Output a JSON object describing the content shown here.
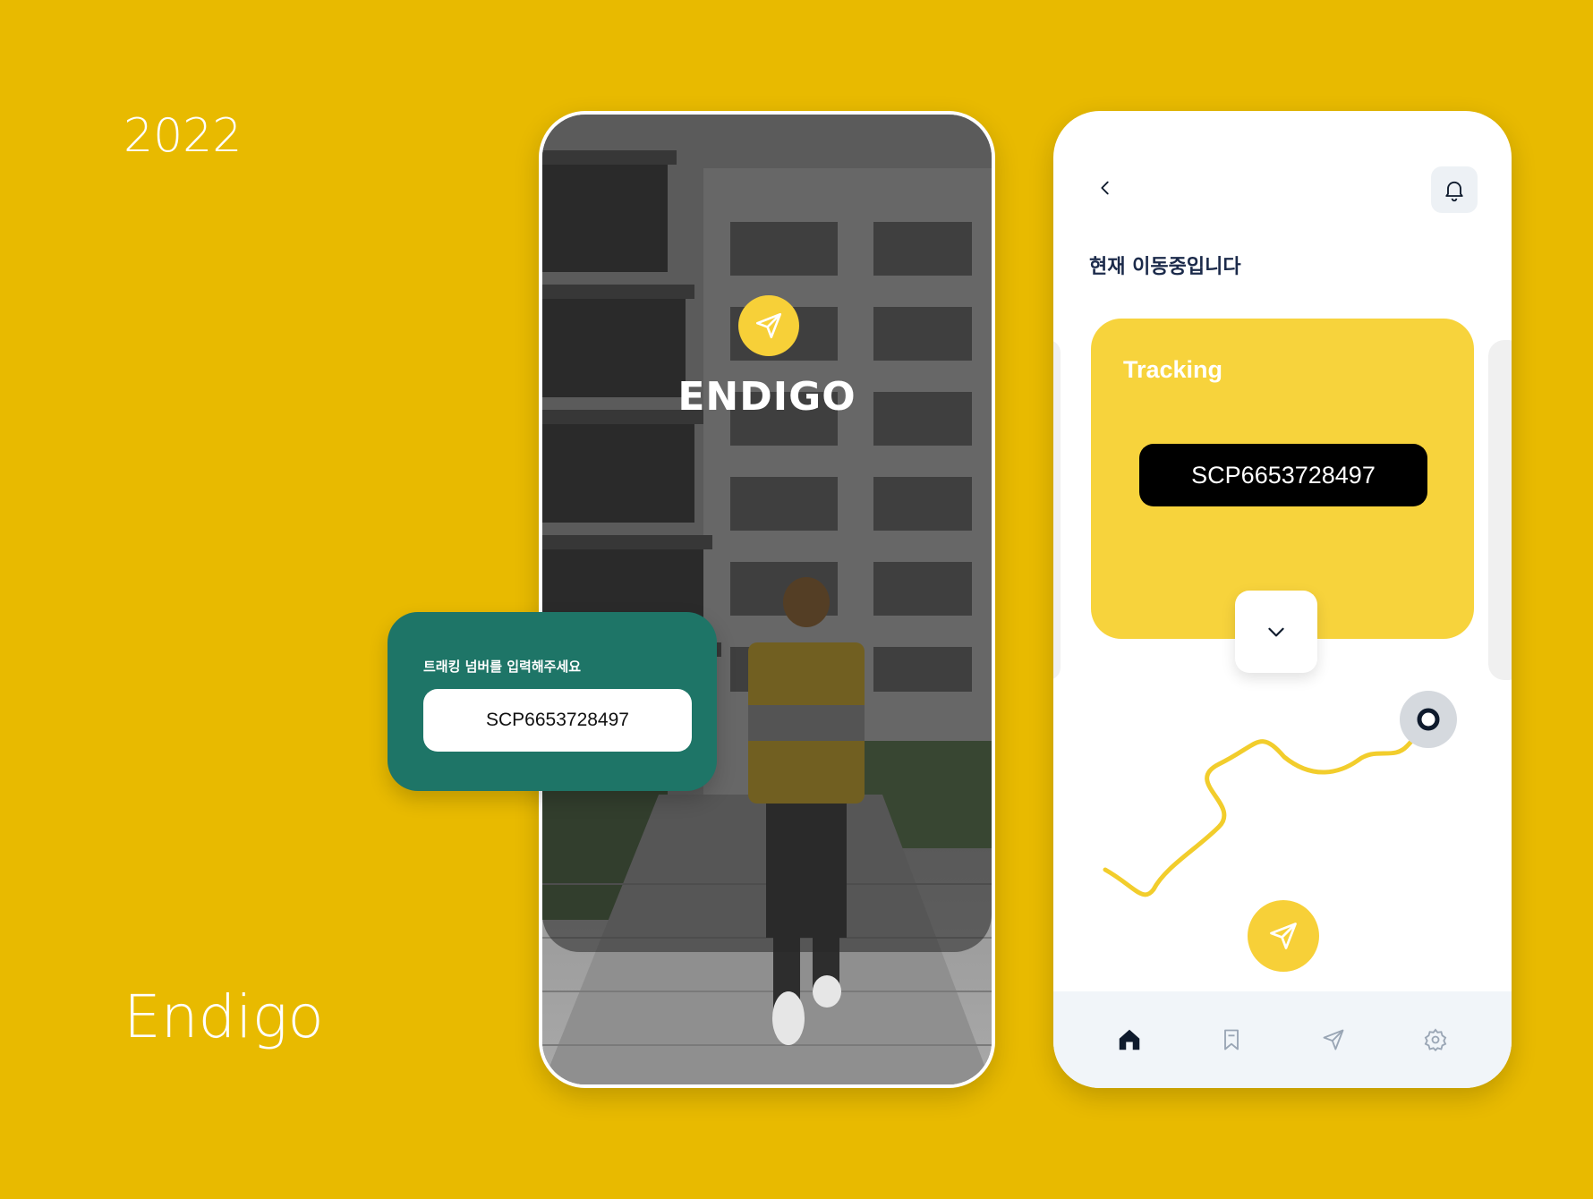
{
  "left_panel": {
    "year": "2022",
    "brand": "Endigo"
  },
  "intro_screen": {
    "logo_icon": "paper-plane-icon",
    "app_name": "ENDIGO"
  },
  "tracking_input_card": {
    "label": "트래킹 넘버를 입력해주세요",
    "input_value": "SCP6653728497"
  },
  "tracking_screen": {
    "status_title": "현재 이동중입니다",
    "card_title": "Tracking",
    "tracking_number": "SCP6653728497",
    "icons": {
      "back": "chevron-left-icon",
      "notifications": "bell-icon",
      "expand": "chevron-down-icon",
      "send": "paper-plane-icon"
    },
    "bottom_nav": [
      "home-icon",
      "bookmark-icon",
      "send-icon",
      "settings-icon"
    ],
    "colors": {
      "accent": "#F7D33C",
      "route": "#F2CD2C",
      "dark": "#0F1B2D"
    }
  },
  "colors": {
    "background": "#E8BA00",
    "card_green": "#1E7567",
    "yellow": "#F7D038"
  }
}
